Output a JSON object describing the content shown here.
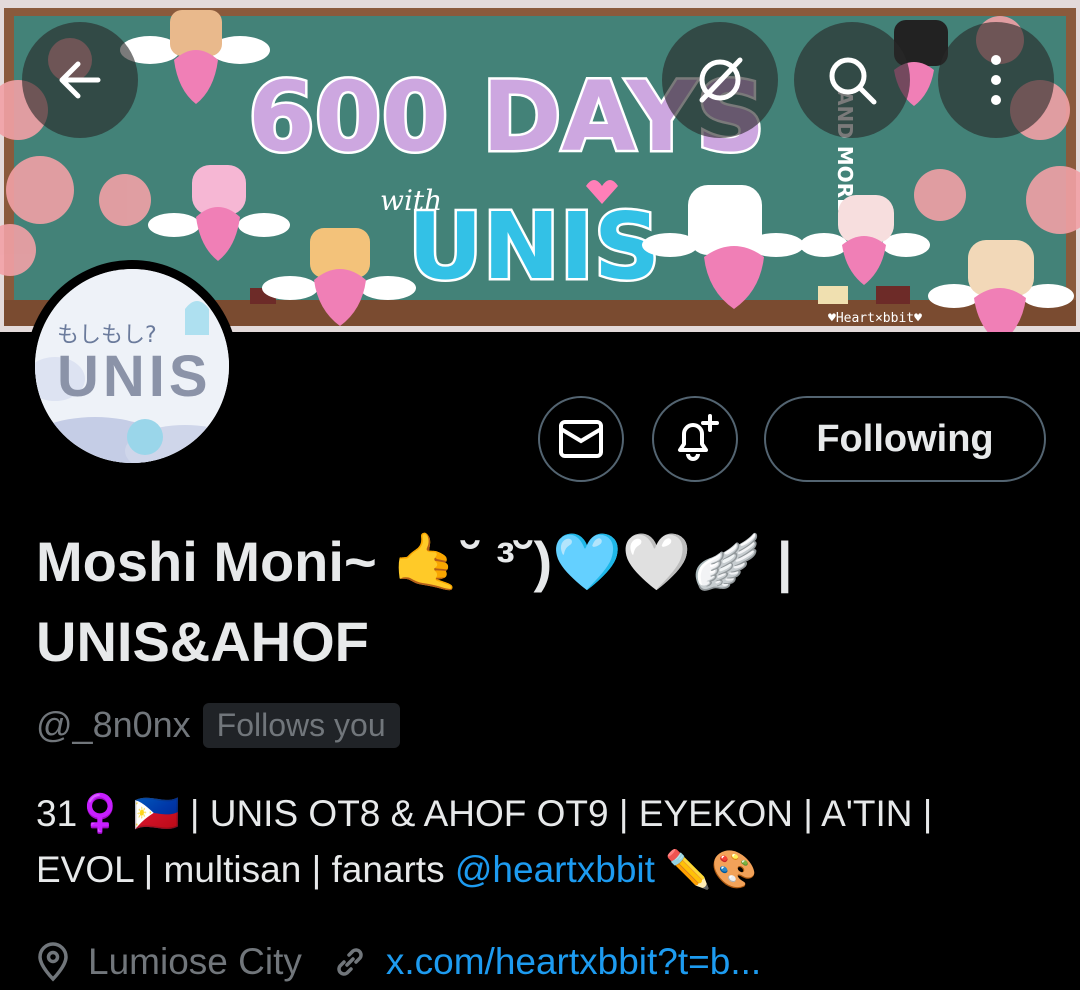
{
  "banner": {
    "headline": "600 DAYS",
    "side_text": "AND MORE",
    "with_text": "with",
    "brand": "UNIS",
    "signature": "♥Heart×bbit♥"
  },
  "avatar": {
    "top_text": "もしもし?",
    "logo_text": "UNIS"
  },
  "actions": {
    "follow_label": "Following"
  },
  "profile": {
    "display_name_line1": "Moshi Moni~ 🤙˘ ³˘)🩵🤍🪽 |",
    "display_name_line2": "UNIS&AHOF",
    "handle": "@_8n0nx",
    "follows_you": "Follows you",
    "bio_line1": "31♀️ 🇵🇭 | UNIS OT8 & AHOF OT9 | EYEKON | A'TIN |",
    "bio_line2_prefix": "EVOL | multisan | fanarts ",
    "bio_mention": "@heartxbbit",
    "bio_line2_suffix": " ✏️🎨",
    "location": "Lumiose City",
    "website": "x.com/heartxbbit?t=b..."
  },
  "colors": {
    "accent": "#1d9bf0",
    "secondary_text": "#71767b",
    "border": "#536471"
  }
}
